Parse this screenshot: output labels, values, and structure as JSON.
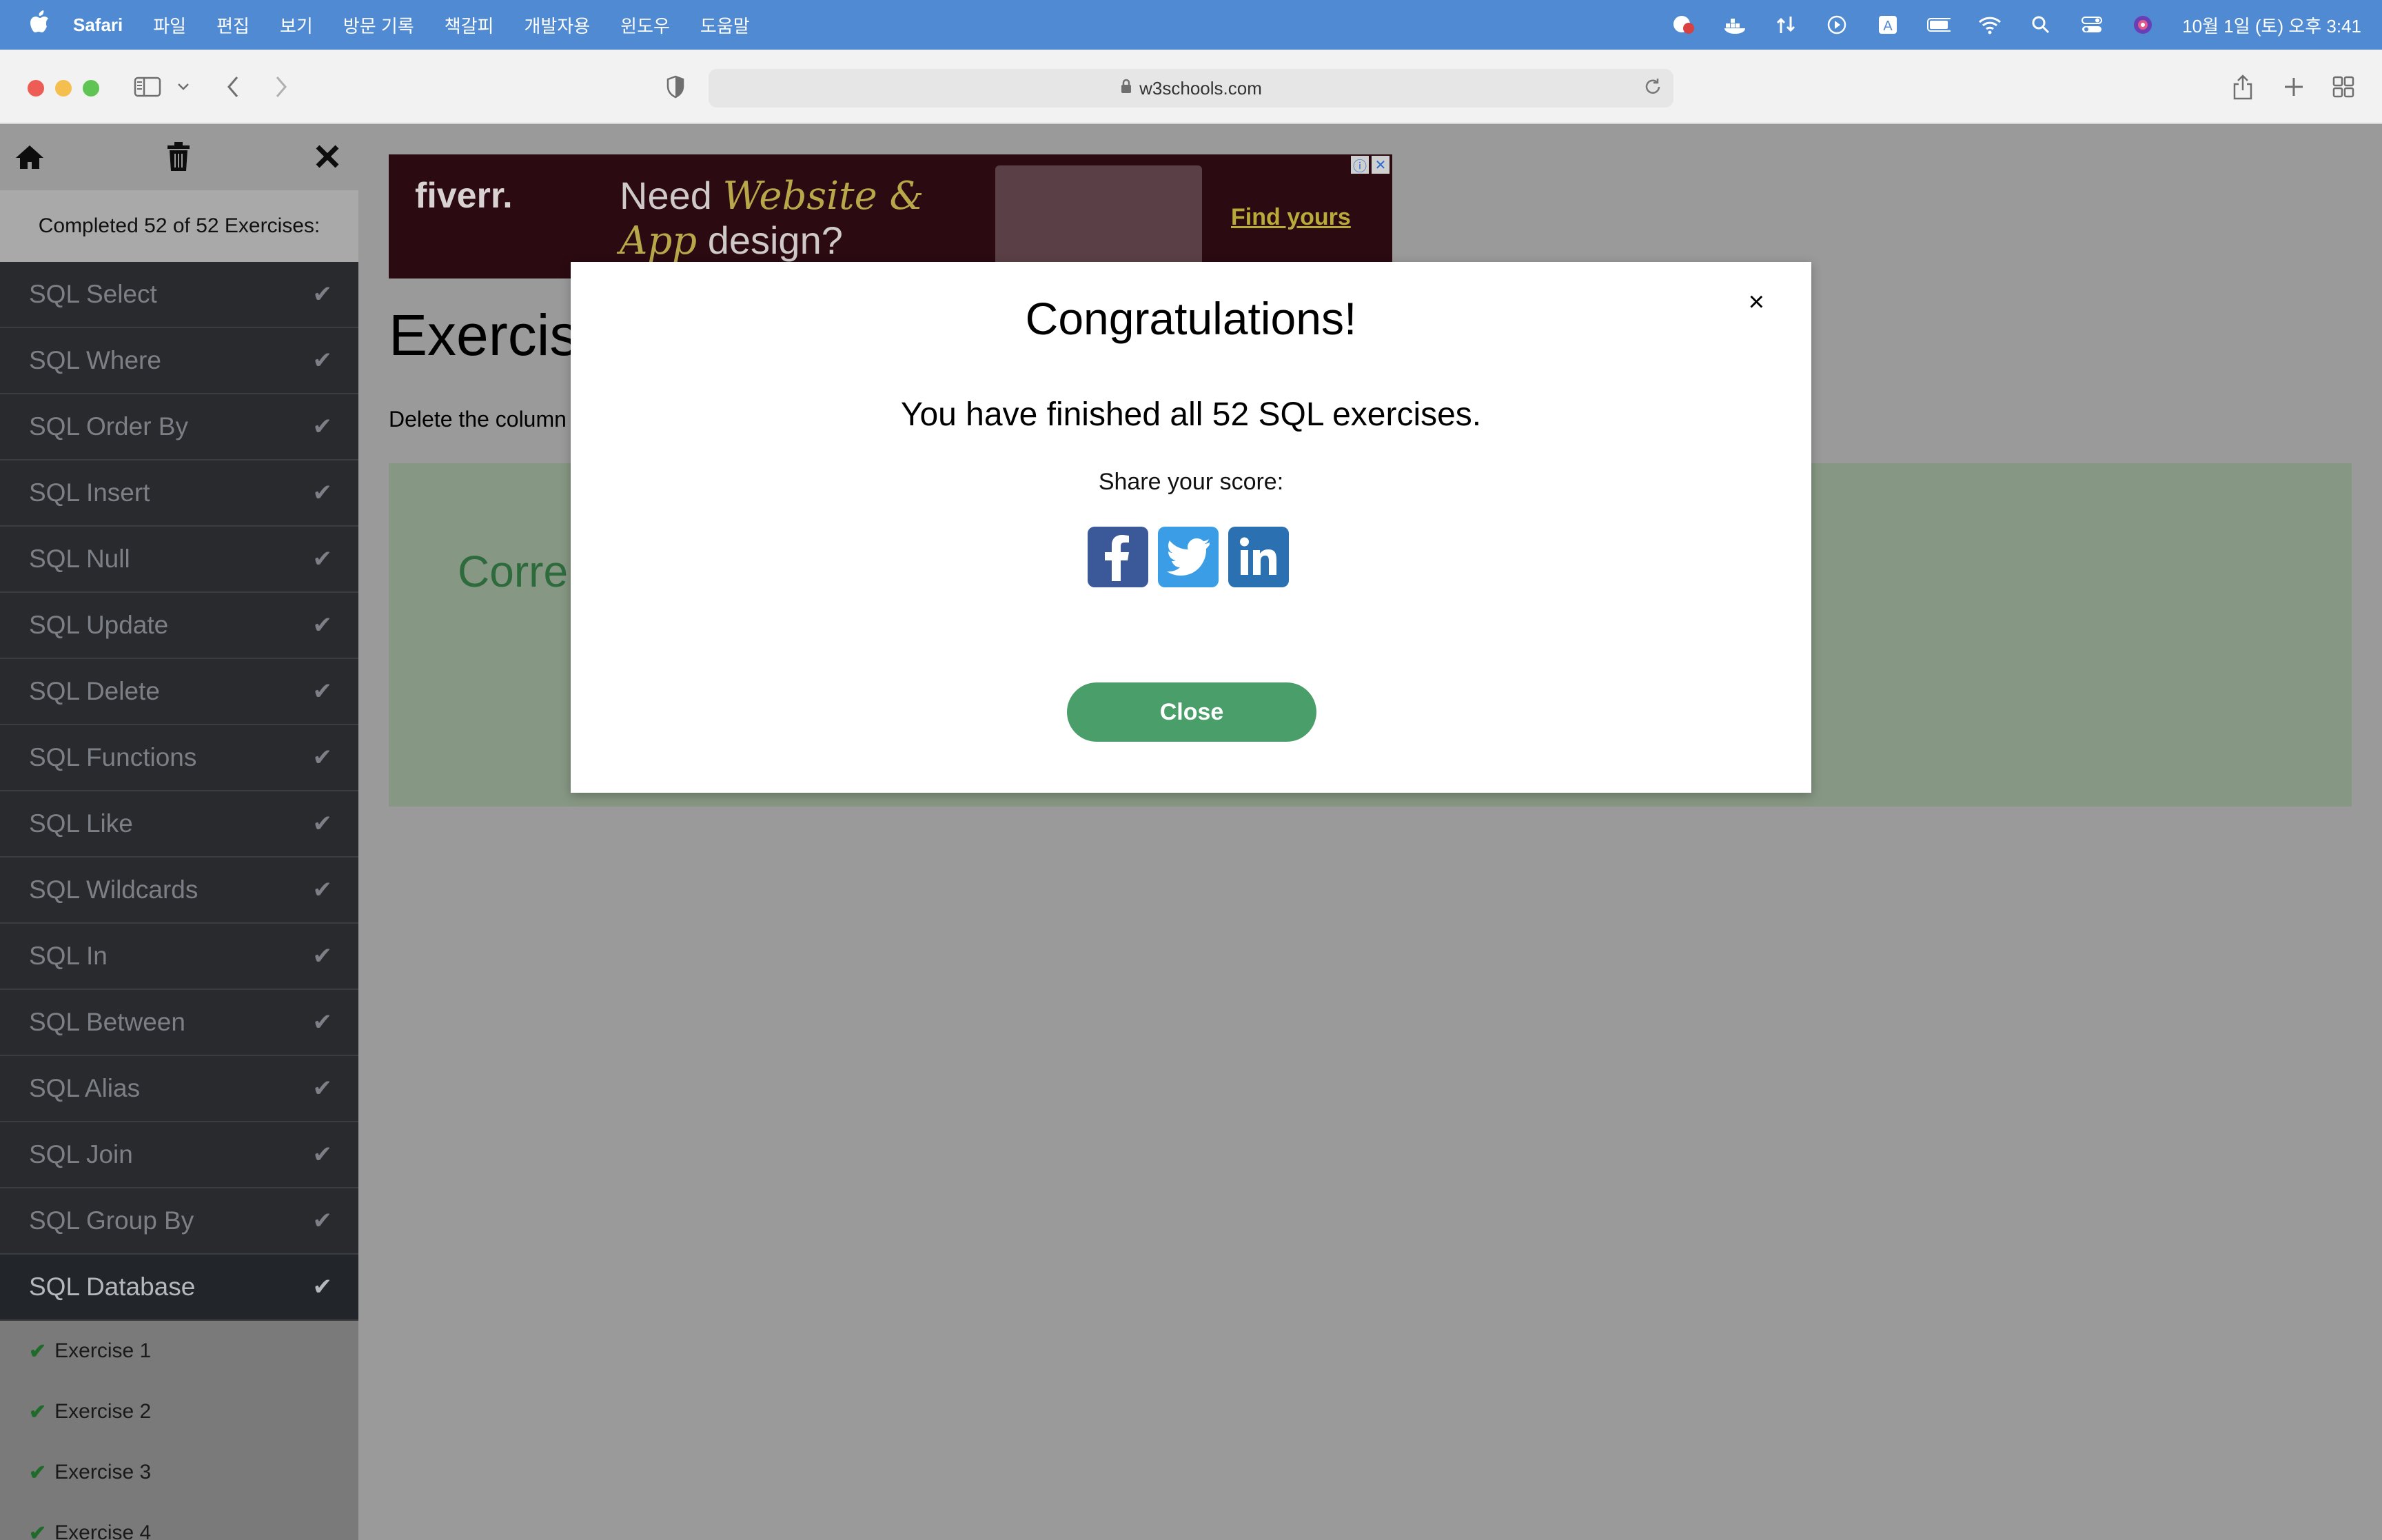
{
  "menubar": {
    "app_name": "Safari",
    "items": [
      "파일",
      "편집",
      "보기",
      "방문 기록",
      "책갈피",
      "개발자용",
      "윈도우",
      "도움말"
    ],
    "clock": "10월 1일 (토) 오후 3:41"
  },
  "browser": {
    "url": "w3schools.com"
  },
  "sidebar": {
    "status": "Completed 52 of 52 Exercises:",
    "items": [
      {
        "label": "SQL Select"
      },
      {
        "label": "SQL Where"
      },
      {
        "label": "SQL Order By"
      },
      {
        "label": "SQL Insert"
      },
      {
        "label": "SQL Null"
      },
      {
        "label": "SQL Update"
      },
      {
        "label": "SQL Delete"
      },
      {
        "label": "SQL Functions"
      },
      {
        "label": "SQL Like"
      },
      {
        "label": "SQL Wildcards"
      },
      {
        "label": "SQL In"
      },
      {
        "label": "SQL Between"
      },
      {
        "label": "SQL Alias"
      },
      {
        "label": "SQL Join"
      },
      {
        "label": "SQL Group By"
      },
      {
        "label": "SQL Database"
      }
    ],
    "sub_items": [
      "Exercise 1",
      "Exercise 2",
      "Exercise 3",
      "Exercise 4"
    ]
  },
  "ad": {
    "logo": "fiverr.",
    "headline_1": "Need",
    "headline_em_1": "Website &",
    "headline_em_2": "App",
    "headline_2": "design?",
    "cta": "Find yours"
  },
  "page": {
    "heading": "Exercis",
    "instruction": "Delete the column",
    "result": "Corre"
  },
  "modal": {
    "title": "Congratulations!",
    "message": "You have finished all 52 SQL exercises.",
    "share_label": "Share your score:",
    "close_label": "Close",
    "close_x": "×"
  },
  "colors": {
    "menubar": "#4f8ad2",
    "sidebar_item_bg": "#282a2d",
    "close_button": "#4a9e6a",
    "facebook": "#3b5998",
    "twitter": "#3b9de6",
    "linkedin": "#2b71b1"
  }
}
